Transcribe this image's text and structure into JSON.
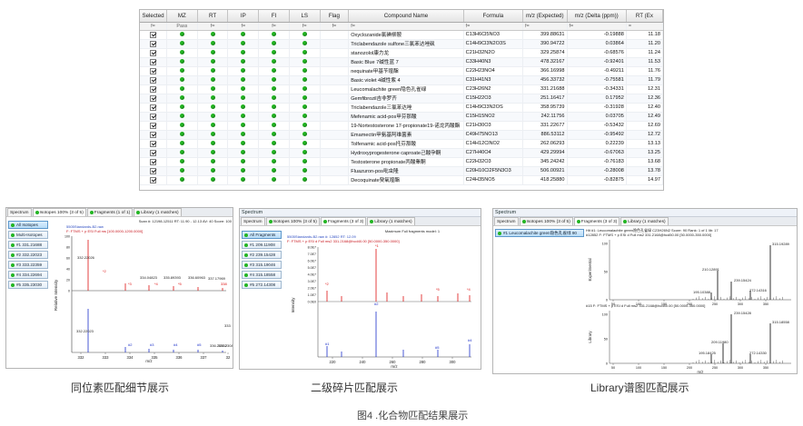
{
  "results_table": {
    "columns": [
      "Selected",
      "MZ",
      "RT",
      "IP",
      "FI",
      "LS",
      "Flag",
      "Compound Name",
      "Formula",
      "m/z (Expected)",
      "m/z (Delta (ppm))",
      "RT (Ex"
    ],
    "filter_row": [
      "f=",
      "Pass",
      "f=",
      "f=",
      "f=",
      "f=",
      "f=",
      "f=",
      "f=",
      "f=",
      "f=",
      "="
    ],
    "rows": [
      {
        "name": "Oxyclozanide氯碘柳胺",
        "formula": "C13H6Cl5NO3",
        "mz": "399.88631",
        "delta": "-0.19888",
        "rt": "11.18"
      },
      {
        "name": "Triclabendazole sulfone三氯苯达唑砜",
        "formula": "C14H9Cl3N2O3S",
        "mz": "390.94722",
        "delta": "0.03864",
        "rt": "11.20"
      },
      {
        "name": "stanozolol康力龙",
        "formula": "C21H32N2O",
        "mz": "329.25874",
        "delta": "-0.68576",
        "rt": "11.24"
      },
      {
        "name": "Basic Blue 7碱性蓝 7",
        "formula": "C33H40N3",
        "mz": "478.32167",
        "delta": "-0.92401",
        "rt": "11.53"
      },
      {
        "name": "nequinate甲基苄喹酯",
        "formula": "C22H23NO4",
        "mz": "366.16998",
        "delta": "-0.49211",
        "rt": "11.76"
      },
      {
        "name": "Basic violet 4碱性紫 4",
        "formula": "C31H41N3",
        "mz": "456.33732",
        "delta": "-0.75581",
        "rt": "11.79"
      },
      {
        "name": "Leucomalachite green隐色孔雀绿",
        "formula": "C23H26N2",
        "mz": "331.21688",
        "delta": "-0.34331",
        "rt": "12.31"
      },
      {
        "name": "Gemfibrozil吉非罗齐",
        "formula": "C15H22O3",
        "mz": "251.16417",
        "delta": "0.17952",
        "rt": "12.36"
      },
      {
        "name": "Triclabendazole三氯苯达唑",
        "formula": "C14H9Cl3N2OS",
        "mz": "358.95739",
        "delta": "-0.31928",
        "rt": "12.40"
      },
      {
        "name": "Mefenamic acid-pos甲芬那酸",
        "formula": "C15H15NO2",
        "mz": "242.11756",
        "delta": "0.03705",
        "rt": "12.49"
      },
      {
        "name": "19-Nortestosterone 17-propionate19-诺龙丙酸酯",
        "formula": "C21H30O3",
        "mz": "331.22677",
        "delta": "-0.53432",
        "rt": "12.69"
      },
      {
        "name": "Emamectin甲氨基阿维菌素",
        "formula": "C49H75NO13",
        "mz": "886.53112",
        "delta": "-0.95492",
        "rt": "12.72"
      },
      {
        "name": "Tolfenamic acid-pos托芬那酸",
        "formula": "C14H12ClNO2",
        "mz": "262.06293",
        "delta": "0.22239",
        "rt": "13.13"
      },
      {
        "name": "Hydroxyprogesterone caproate己酸孕酮",
        "formula": "C27H40O4",
        "mz": "429.29994",
        "delta": "-0.67063",
        "rt": "13.25"
      },
      {
        "name": "Testosterone propionate丙酸睾酮",
        "formula": "C22H32O3",
        "mz": "345.24242",
        "delta": "-0.76183",
        "rt": "13.68"
      },
      {
        "name": "Fluazuron-pos吡虫隆",
        "formula": "C20H10Cl2F5N3O3",
        "mz": "506.00921",
        "delta": "-0.28008",
        "rt": "13.78"
      },
      {
        "name": "Decoquinate癸氧喹酯",
        "formula": "C24H35NO5",
        "mz": "418.25880",
        "delta": "-0.82875",
        "rt": "14.97"
      }
    ]
  },
  "isotope_panel": {
    "tabs": [
      "Spectrum",
      "Isotopes 100% (3 of 5)",
      "Fragments (1 of 1)",
      "Library (1 matches)"
    ],
    "side_items": [
      "All Isotopes",
      "Multi-Isotopes",
      "#1 331.21688",
      "#2 332.22023",
      "#3 333.22359",
      "#4 334.22694",
      "#5 335.23030"
    ],
    "header_right": "Scan #: 12198-12511   RT: 11.90 - 12.13   AV: 40   Score: 100",
    "header_left": "5505Standards-B2.raw",
    "filter": "F: FTMS + p ESI Full ms [100.0000-1200.0000]",
    "top_labels": [
      "332.22026",
      "334.04823",
      "335.89393",
      "336.60963",
      "337.17969"
    ],
    "top_small_labels": [
      "*2",
      "*3",
      "*4",
      "*5",
      "338"
    ],
    "bottom_labels": [
      "332.22023",
      "#2",
      "#3",
      "#4",
      "#5",
      "336.21362",
      "337.23085",
      "333"
    ],
    "y_label": "Relative Intensity",
    "x_label": "m/z",
    "x_ticks": [
      "332",
      "333",
      "334",
      "335",
      "336",
      "337",
      "32"
    ],
    "y_ticks": [
      "100",
      "80",
      "60",
      "40",
      "20",
      "0"
    ]
  },
  "fragment_panel": {
    "title": "Spectrum",
    "tabs": [
      "Spectrum",
      "Isotopes 100% (3 of 5)",
      "Fragments (3 of 3)",
      "Library (1 matches)"
    ],
    "side_items": [
      "All Fragments",
      "#1 209.11908",
      "#2 239.15428",
      "#3 315.19046",
      "#4 315.18558",
      "#5 272.14308"
    ],
    "header_top": "Maximum Full fragments model: 1",
    "header_left": "5505Standards-B2.raw   #: 12852   RT: 12.09",
    "filter": "F: FTMS + p ESI d Full ms2 331.2168@hcd40.00 [50.0000-350.0000]",
    "y_ticks": [
      "8.0E7",
      "7.0E7",
      "6.0E7",
      "5.0E7",
      "4.0E7",
      "3.0E7",
      "2.0E7",
      "1.0E7",
      "0.0E0"
    ],
    "x_ticks": [
      "220",
      "240",
      "260",
      "280",
      "300"
    ],
    "peak_labels": [
      "*2",
      "*1",
      "*5",
      "#2",
      "#1",
      "#5",
      "#4",
      "*4"
    ],
    "y_label": "Intensity",
    "x_label": "m/z"
  },
  "library_panel": {
    "title": "Spectrum",
    "tabs": [
      "Spectrum",
      "Isotopes 100% (3 of 5)",
      "Fragments (3 of 3)",
      "Library (1 matches)"
    ],
    "side_item": "#1 Leucomalachite green隐色孔雀绿 90",
    "top_header": "Hit #1: Leucomalachite green隐色孔雀绿   C23H26N2   Score: 90   Rank: 1 of 1   lib: 17",
    "top_filter": "#12852   F: FTMS + p ESI d Full ms2 331.2168@hcd50.00 [50.0000-350.0000]",
    "top_peaks": [
      "315.19289",
      "210.12891",
      "239.15424",
      "195.10388",
      "272.14316"
    ],
    "top_ylabel": "Experimental",
    "bottom_filter": "#15   F: FTMS + p ESI d Full ms2 331.2168@hcd40.00 [50.0000-350.0000]",
    "bottom_peaks": [
      "239.15428",
      "315.18558",
      "209.11980",
      "195.18425",
      "272.14330"
    ],
    "bottom_ylabel": "Library",
    "y_ticks": [
      "100",
      "50",
      "0"
    ],
    "x_ticks": [
      "50",
      "100",
      "150",
      "200",
      "250",
      "300",
      "350"
    ],
    "x_label": "m/z"
  },
  "captions": {
    "isotope": "同位素匹配细节展示",
    "fragment": "二级碎片匹配展示",
    "library": "Library谱图匹配展示",
    "figure": "图4 .化合物匹配结果展示"
  }
}
